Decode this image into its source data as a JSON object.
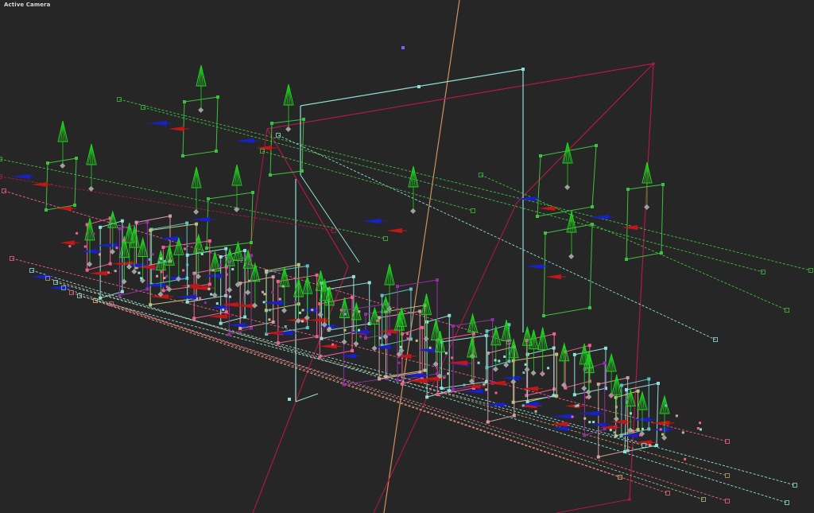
{
  "viewport": {
    "camera_label": "Active Camera"
  },
  "colors": {
    "background": "#262626",
    "green_guide": "#3fbf3f",
    "cyan_guide": "#8fe0d8",
    "crimson_guide": "#b3184a",
    "pink_guide": "#f06090",
    "orange_line": "#d09060",
    "magenta_guide": "#9030a0",
    "red_arrow": "#c01818",
    "blue_arrow": "#1820c8",
    "cone_green": "#20d020"
  },
  "icons": {
    "cone": "cone-light-icon",
    "arrow": "direction-arrow-icon",
    "diamond": "origin-diamond-icon"
  }
}
